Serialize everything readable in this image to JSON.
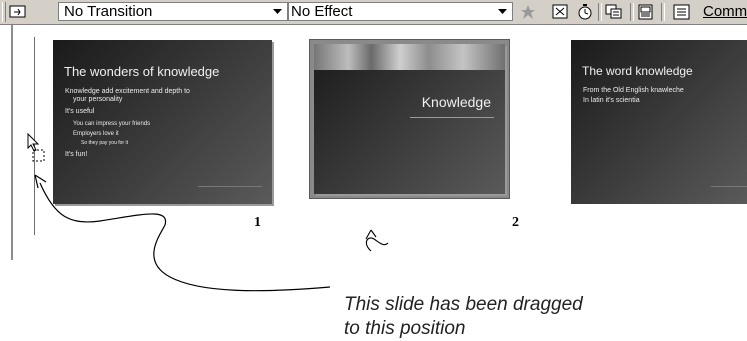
{
  "toolbar": {
    "transition_select": {
      "value": "No Transition"
    },
    "effect_select": {
      "value": "No Effect"
    },
    "common_tasks_label": "Common",
    "icons": [
      "slide-show-icon",
      "animation-star-icon",
      "hide-slide-icon",
      "rehearse-timings-icon",
      "summary-slide-icon",
      "speaker-notes-icon"
    ]
  },
  "slides": [
    {
      "number": "1",
      "title": "The wonders of knowledge",
      "bullets": [
        "Knowledge add excitement and depth to",
        "your personality",
        "It's useful",
        "You can impress your friends",
        "Employers love it",
        "So they pay you for it",
        "It's fun!"
      ]
    },
    {
      "number": "2",
      "title": "Knowledge",
      "selected": true
    },
    {
      "number": "",
      "title": "The word knowledge",
      "bullets": [
        "From the Old English knawleche",
        "In latin it's scientia"
      ]
    }
  ],
  "annotation": {
    "caption_line1": "This slide has been dragged",
    "caption_line2": "to this position"
  },
  "colors": {
    "toolbar_bg": "#d4d0c8",
    "slide_bg": "#2e2e2e",
    "selection_frame": "#8a8a8a"
  }
}
